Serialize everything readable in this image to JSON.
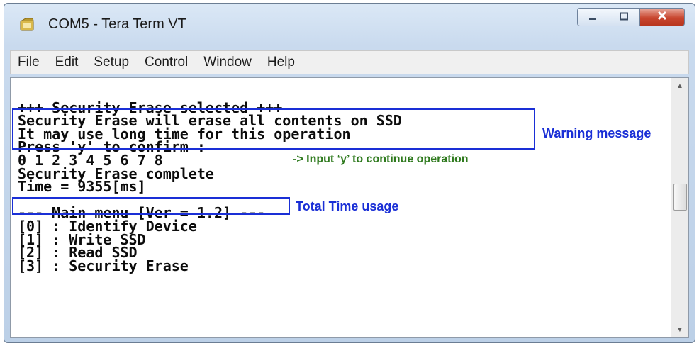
{
  "window": {
    "title": "COM5 - Tera Term VT"
  },
  "menu": [
    "File",
    "Edit",
    "Setup",
    "Control",
    "Window",
    "Help"
  ],
  "terminal_lines": [
    "",
    "+++ Security Erase selected +++",
    "Security Erase will erase all contents on SSD",
    "It may use long time for this operation",
    "Press 'y' to confirm :",
    "0 1 2 3 4 5 6 7 8",
    "Security Erase complete",
    "Time = 9355[ms]",
    "",
    "--- Main menu [Ver = 1.2] ---",
    "[0] : Identify Device",
    "[1] : Write SSD",
    "[2] : Read SSD",
    "[3] : Security Erase"
  ],
  "annotations": {
    "warning": "Warning message",
    "confirm": "-> Input ‘y’ to continue operation",
    "time": "Total Time usage"
  },
  "colors": {
    "annotation_blue": "#1a2fd6",
    "annotation_green": "#2f7a1e",
    "close_button": "#c8462f"
  },
  "icons": [
    "tera-term-app-icon",
    "minimize-icon",
    "maximize-icon",
    "close-icon",
    "scroll-up-icon",
    "scroll-down-icon"
  ]
}
